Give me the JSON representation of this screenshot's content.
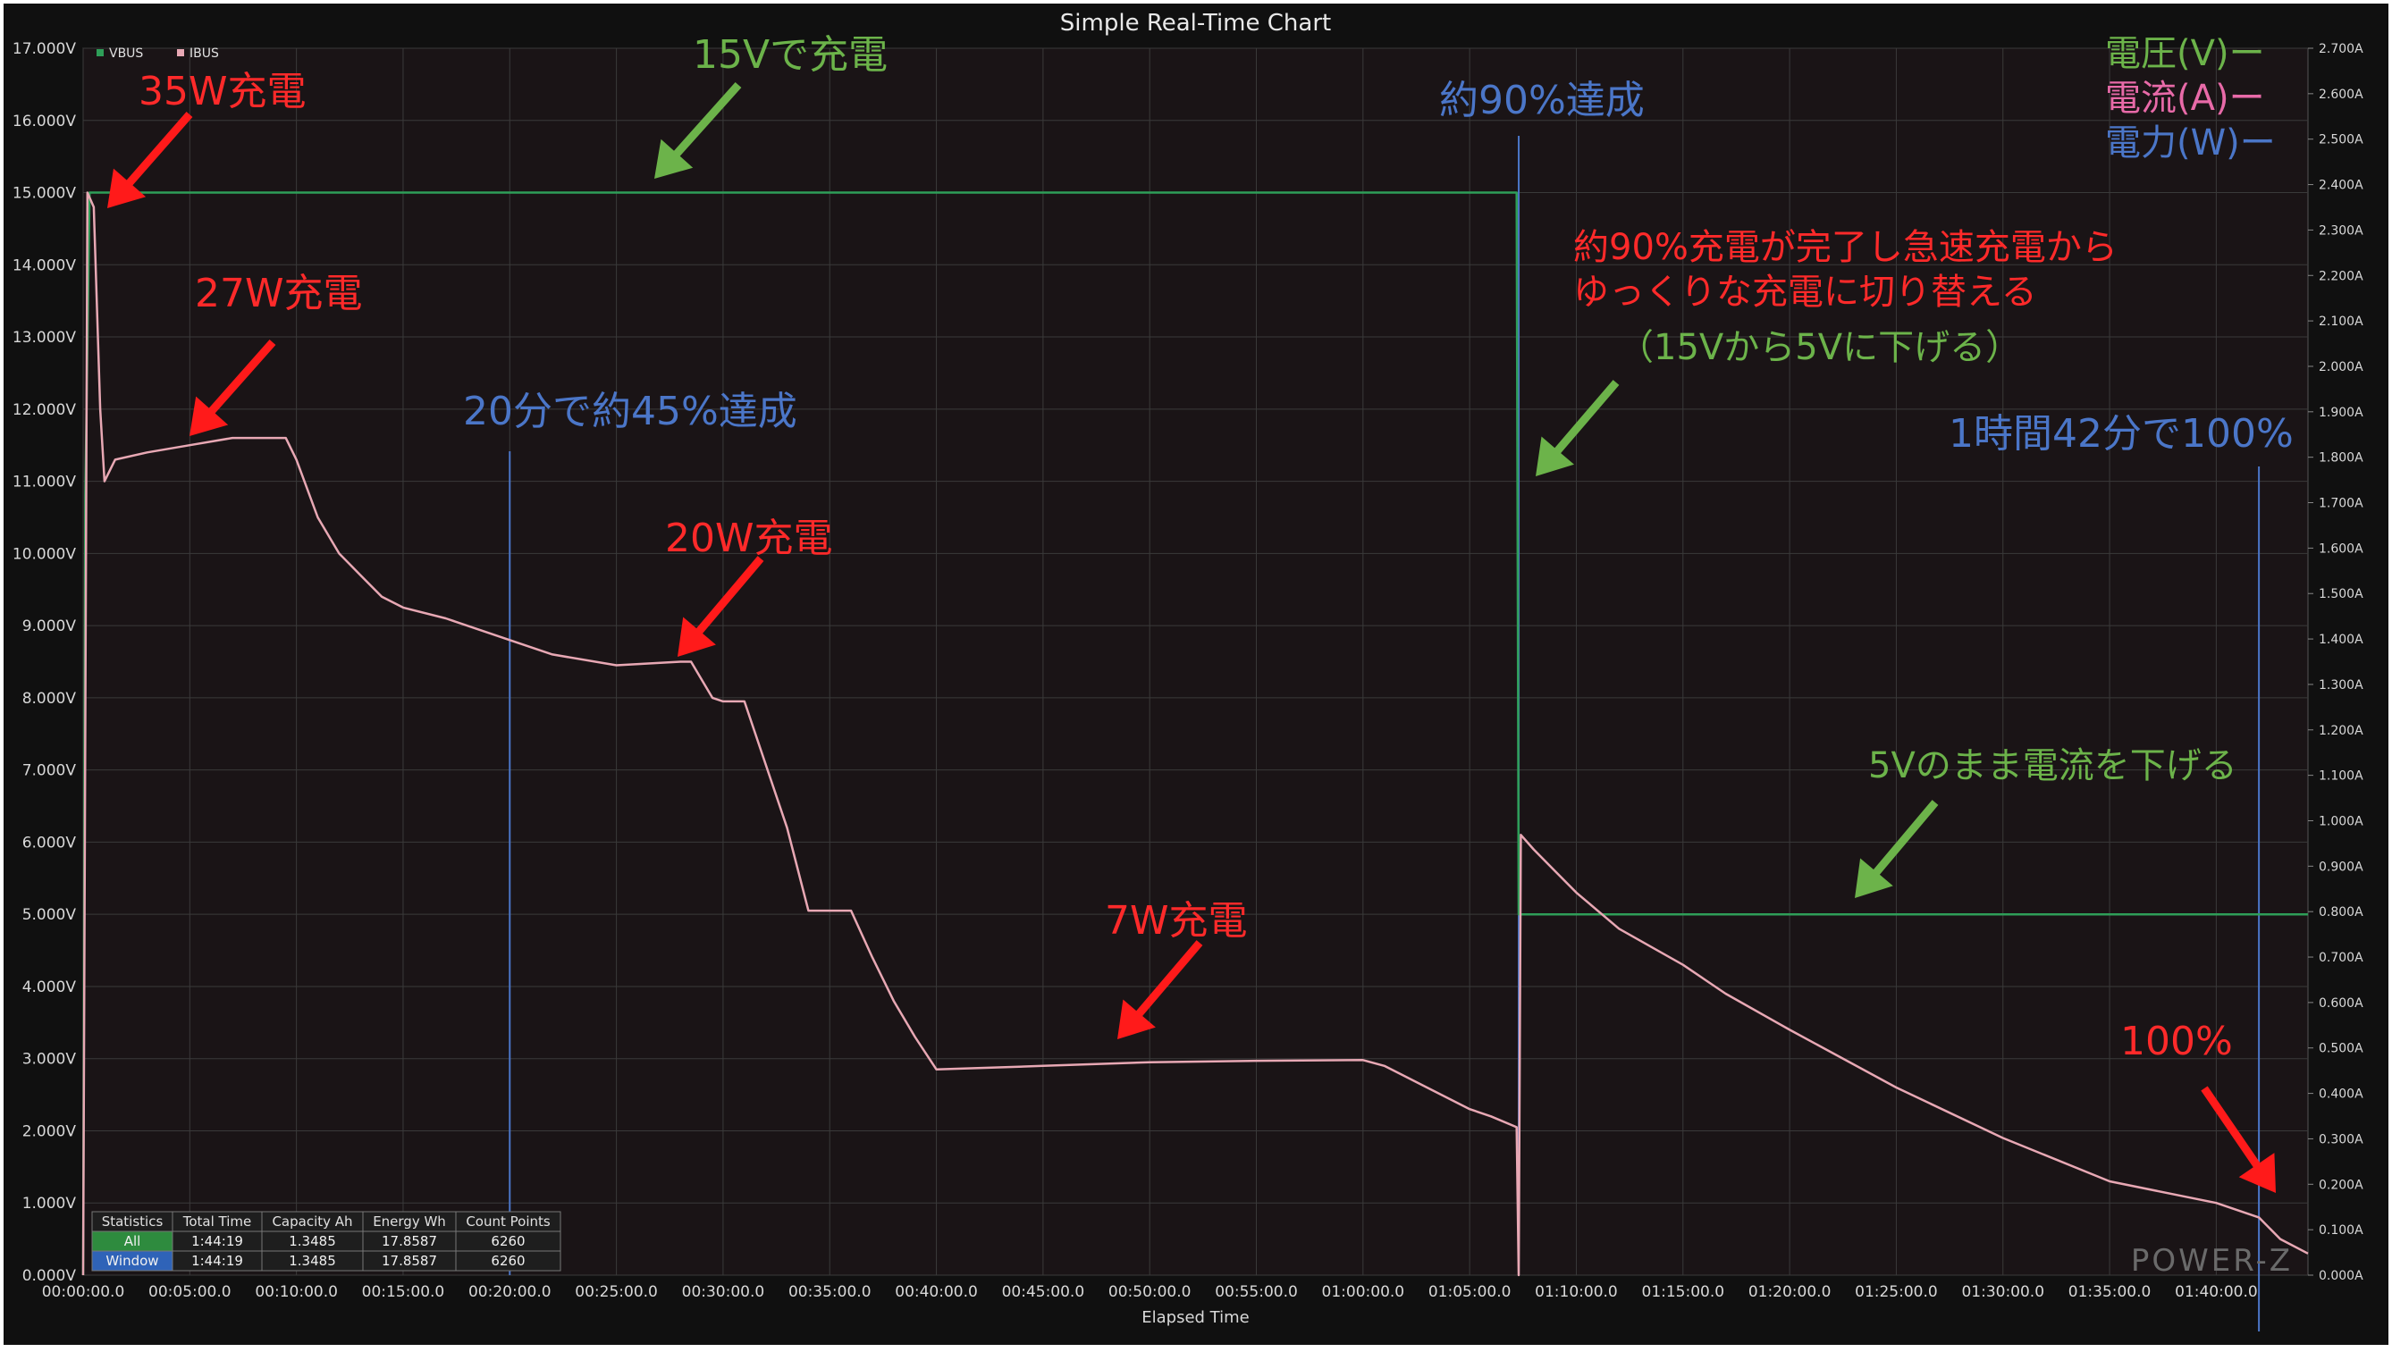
{
  "chart_data": {
    "type": "line",
    "title": "Simple Real-Time Chart",
    "xlabel": "Elapsed Time",
    "x_unit": "minutes",
    "xlim": [
      0,
      104.3
    ],
    "x_ticks": [
      "00:00:00.0",
      "00:05:00.0",
      "00:10:00.0",
      "00:15:00.0",
      "00:20:00.0",
      "00:25:00.0",
      "00:30:00.0",
      "00:35:00.0",
      "00:40:00.0",
      "00:45:00.0",
      "00:50:00.0",
      "00:55:00.0",
      "01:00:00.0",
      "01:05:00.0",
      "01:10:00.0",
      "01:15:00.0",
      "01:20:00.0",
      "01:25:00.0",
      "01:30:00.0",
      "01:35:00.0",
      "01:40:00.0"
    ],
    "y_left": {
      "lim": [
        0,
        17
      ],
      "ticks": [
        "0.000V",
        "1.000V",
        "2.000V",
        "3.000V",
        "4.000V",
        "5.000V",
        "6.000V",
        "7.000V",
        "8.000V",
        "9.000V",
        "10.000V",
        "11.000V",
        "12.000V",
        "13.000V",
        "14.000V",
        "15.000V",
        "16.000V",
        "17.000V"
      ]
    },
    "y_right": {
      "lim": [
        0,
        2.7
      ],
      "ticks": [
        "0.000A",
        "0.100A",
        "0.200A",
        "0.300A",
        "0.400A",
        "0.500A",
        "0.600A",
        "0.700A",
        "0.800A",
        "0.900A",
        "1.000A",
        "1.100A",
        "1.200A",
        "1.300A",
        "1.400A",
        "1.500A",
        "1.600A",
        "1.700A",
        "1.800A",
        "1.900A",
        "2.000A",
        "2.100A",
        "2.200A",
        "2.300A",
        "2.400A",
        "2.500A",
        "2.600A",
        "2.700A"
      ]
    },
    "grid": true,
    "legend": {
      "placement": "top-left",
      "items": [
        {
          "label": "VBUS",
          "color": "#2e9e58"
        },
        {
          "label": "IBUS",
          "color": "#e8a8b4"
        }
      ]
    },
    "series": [
      {
        "name": "VBUS",
        "axis": "left",
        "color": "#2e9e58",
        "x": [
          0,
          0.1,
          0.3,
          0.5,
          0.6,
          1,
          10,
          20,
          30,
          40,
          50,
          60,
          67.2,
          67.3,
          70,
          80,
          90,
          100,
          104.3
        ],
        "y": [
          0,
          10.8,
          15.0,
          15.0,
          15.0,
          15.0,
          15.0,
          15.0,
          15.0,
          15.0,
          15.0,
          15.0,
          15.0,
          5.0,
          5.0,
          5.0,
          5.0,
          5.0,
          5.0
        ]
      },
      {
        "name": "IBUS",
        "axis": "left",
        "color": "#e8a8b4",
        "x": [
          0,
          0.2,
          0.5,
          0.8,
          1.0,
          1.5,
          3,
          5,
          7,
          9.5,
          10,
          11,
          12,
          13,
          14,
          15,
          17,
          20,
          22,
          25,
          28,
          28.5,
          29.5,
          30,
          31,
          33,
          34,
          35,
          36,
          37,
          38,
          39,
          40,
          45,
          50,
          55,
          60,
          61,
          62,
          63,
          64,
          65,
          66,
          67.2,
          67.3,
          67.4,
          68,
          69,
          70,
          72,
          75,
          77,
          80,
          85,
          90,
          95,
          100,
          101,
          102,
          103,
          104.3
        ],
        "y": [
          0,
          15.0,
          14.8,
          12.0,
          11.0,
          11.3,
          11.4,
          11.5,
          11.6,
          11.6,
          11.3,
          10.5,
          10.0,
          9.7,
          9.4,
          9.25,
          9.1,
          8.8,
          8.6,
          8.45,
          8.5,
          8.5,
          8.0,
          7.95,
          7.95,
          6.2,
          5.05,
          5.05,
          5.05,
          4.4,
          3.8,
          3.3,
          2.85,
          2.9,
          2.95,
          2.97,
          2.98,
          2.9,
          2.75,
          2.6,
          2.45,
          2.3,
          2.2,
          2.05,
          0.0,
          6.1,
          5.9,
          5.6,
          5.3,
          4.8,
          4.3,
          3.9,
          3.4,
          2.6,
          1.9,
          1.3,
          1.0,
          0.9,
          0.8,
          0.5,
          0.3
        ]
      }
    ],
    "annotations": [
      {
        "text": "35W充電",
        "color": "#ff2a2a"
      },
      {
        "text": "15Vで充電",
        "color": "#6cb34a"
      },
      {
        "text": "約90%達成",
        "color": "#4b76c8"
      },
      {
        "text": "電圧(V)ー",
        "color": "#6cb34a"
      },
      {
        "text": "電流(A)ー",
        "color": "#e86aa8"
      },
      {
        "text": "電力(W)ー",
        "color": "#4b76c8"
      },
      {
        "text": "27W充電",
        "color": "#ff2a2a"
      },
      {
        "text": "約90%充電が完了し急速充電から",
        "color": "#ff2a2a"
      },
      {
        "text": "ゆっくりな充電に切り替える",
        "color": "#ff2a2a"
      },
      {
        "text": "（15Vから5Vに下げる）",
        "color": "#6cb34a"
      },
      {
        "text": "20分で約45%達成",
        "color": "#4b76c8"
      },
      {
        "text": "1時間42分で100%",
        "color": "#4b76c8"
      },
      {
        "text": "20W充電",
        "color": "#ff2a2a"
      },
      {
        "text": "5Vのまま電流を下げる",
        "color": "#6cb34a"
      },
      {
        "text": "7W充電",
        "color": "#ff2a2a"
      },
      {
        "text": "100%",
        "color": "#ff2a2a"
      }
    ],
    "markers": [
      {
        "x": 20,
        "label": "20分で約45%達成"
      },
      {
        "x": 67.3,
        "label": "約90%達成"
      },
      {
        "x": 102,
        "label": "1時間42分で100%"
      }
    ],
    "statistics_table": {
      "headers": [
        "Statistics",
        "Total Time",
        "Capacity Ah",
        "Energy Wh",
        "Count Points"
      ],
      "rows": [
        [
          "All",
          "1:44:19",
          "1.3485",
          "17.8587",
          "6260"
        ],
        [
          "Window",
          "1:44:19",
          "1.3485",
          "17.8587",
          "6260"
        ]
      ]
    },
    "watermark": "POWER-Z"
  }
}
